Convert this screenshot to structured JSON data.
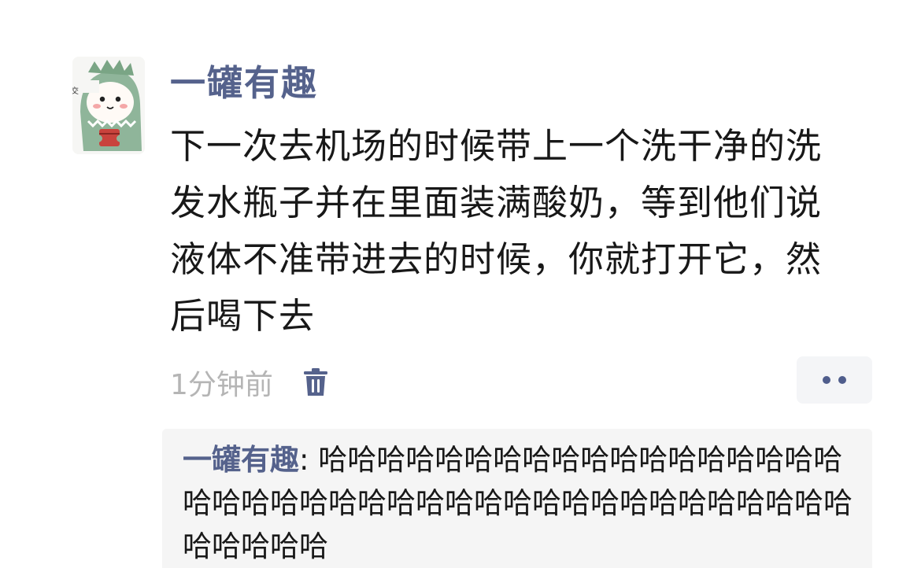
{
  "post": {
    "avatar_icon": "dinosaur-hood-avatar-icon",
    "avatar_caption": "老实巴交",
    "username": "一罐有趣",
    "content": "下一次去机场的时候带上一个洗干净的洗发水瓶子并在里面装满酸奶，等到他们说液体不准带进去的时候，你就打开它，然后喝下去",
    "time": "1分钟前",
    "delete_icon": "trash-icon",
    "more_icon": "more-dots-icon"
  },
  "comment": {
    "author": "一罐有趣",
    "separator": ": ",
    "text": "哈哈哈哈哈哈哈哈哈哈哈哈哈哈哈哈哈哈哈哈哈哈哈哈哈哈哈哈哈哈哈哈哈哈哈哈哈哈哈哈哈哈哈哈哈哈"
  },
  "colors": {
    "username": "#55628c",
    "text": "#181818",
    "meta": "#b5b5b5",
    "comment_bg": "#f5f5f5",
    "accent": "#4f5d8c"
  }
}
